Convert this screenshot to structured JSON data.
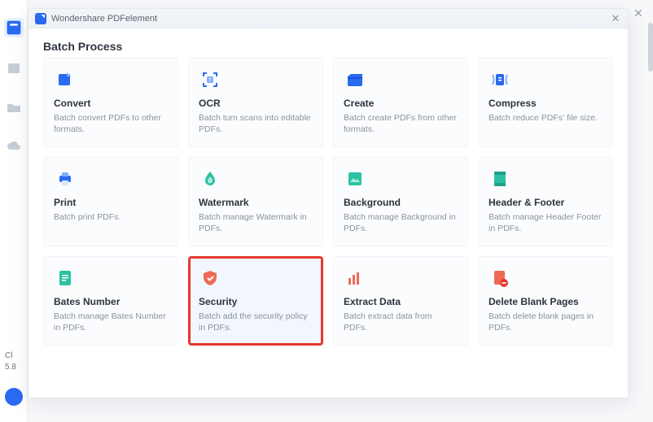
{
  "app": {
    "title": "Wondershare PDFelement"
  },
  "left_panel": {
    "line1": "Cl",
    "line2": "5.8"
  },
  "modal": {
    "heading": "Batch Process",
    "cards": [
      {
        "id": "convert",
        "title": "Convert",
        "desc": "Batch convert PDFs to other formats."
      },
      {
        "id": "ocr",
        "title": "OCR",
        "desc": "Batch turn scans into editable PDFs."
      },
      {
        "id": "create",
        "title": "Create",
        "desc": "Batch create PDFs from other formats."
      },
      {
        "id": "compress",
        "title": "Compress",
        "desc": "Batch reduce PDFs' file size."
      },
      {
        "id": "print",
        "title": "Print",
        "desc": "Batch print PDFs."
      },
      {
        "id": "watermark",
        "title": "Watermark",
        "desc": "Batch manage Watermark in PDFs."
      },
      {
        "id": "background",
        "title": "Background",
        "desc": "Batch manage Background in PDFs."
      },
      {
        "id": "headerfooter",
        "title": "Header & Footer",
        "desc": "Batch manage Header  Footer in PDFs."
      },
      {
        "id": "bates",
        "title": "Bates Number",
        "desc": "Batch manage Bates Number in PDFs."
      },
      {
        "id": "security",
        "title": "Security",
        "desc": "Batch add the security policy in PDFs."
      },
      {
        "id": "extract",
        "title": "Extract Data",
        "desc": "Batch extract data from PDFs."
      },
      {
        "id": "deleteblank",
        "title": "Delete Blank Pages",
        "desc": "Batch delete blank pages in PDFs."
      }
    ],
    "highlighted": "security"
  },
  "colors": {
    "accent_blue": "#2a6af1",
    "accent_teal": "#2cc1a3",
    "accent_coral": "#ee6a58",
    "highlight_red": "#e53a2e"
  }
}
